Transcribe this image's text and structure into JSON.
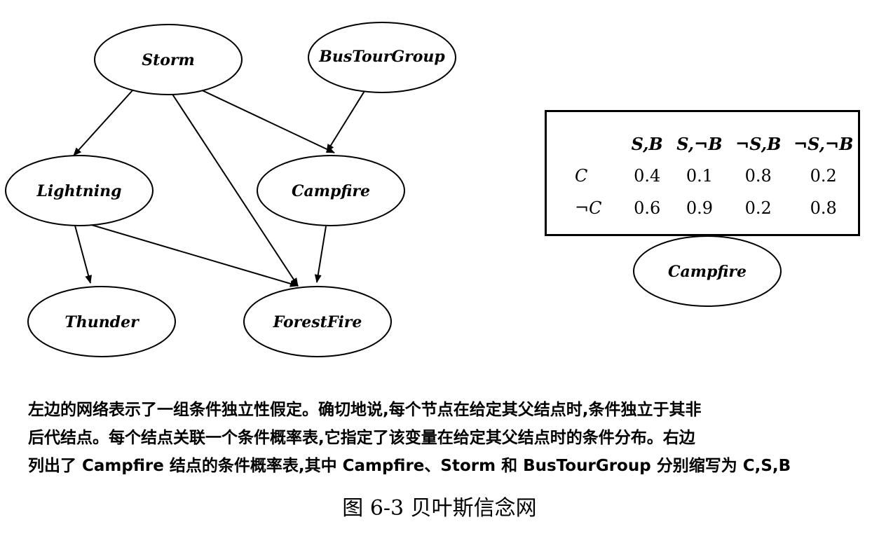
{
  "network": {
    "nodes": {
      "storm": "Storm",
      "bus_tour_group": "BusTourGroup",
      "lightning": "Lightning",
      "campfire": "Campfire",
      "thunder": "Thunder",
      "forest_fire": "ForestFire"
    }
  },
  "cpt": {
    "columns": [
      "S,B",
      "S,¬B",
      "¬S,B",
      "¬S,¬B"
    ],
    "rows": [
      {
        "label": "C",
        "values": [
          "0.4",
          "0.1",
          "0.8",
          "0.2"
        ]
      },
      {
        "label": "¬C",
        "values": [
          "0.6",
          "0.9",
          "0.2",
          "0.8"
        ]
      }
    ],
    "node_label": "Campfire"
  },
  "caption": {
    "lines": [
      "左边的网络表示了一组条件独立性假定。确切地说,每个节点在给定其父结点时,条件独立于其非",
      "后代结点。每个结点关联一个条件概率表,它指定了该变量在给定其父结点时的条件分布。右边",
      "列出了 Campfire 结点的条件概率表,其中 Campfire、Storm 和 BusTourGroup 分别缩写为 C,S,B"
    ]
  },
  "figure_title": "图 6-3   贝叶斯信念网"
}
